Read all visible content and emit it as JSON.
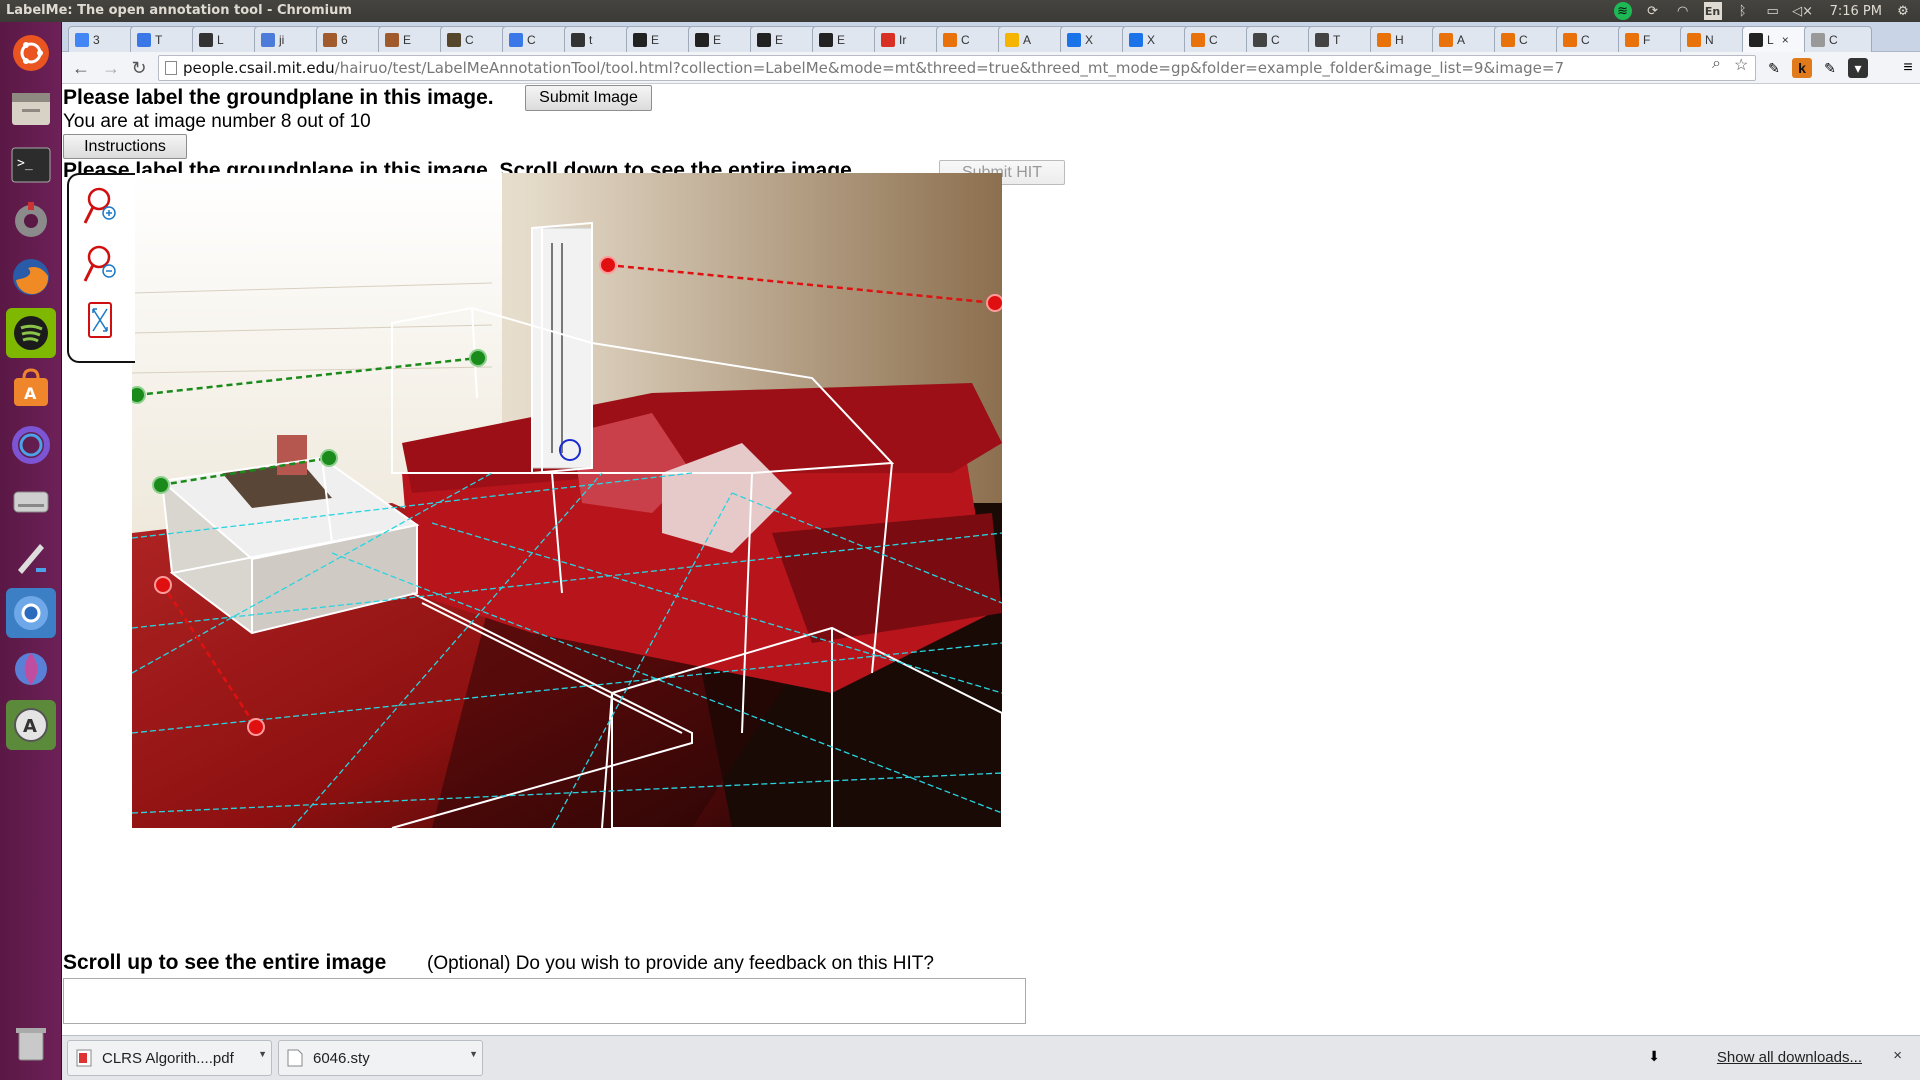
{
  "window": {
    "title": "LabelMe: The open annotation tool - Chromium"
  },
  "tray": {
    "language": "En",
    "clock": "7:16 PM"
  },
  "launcher": {
    "items": [
      "ubuntu-dash-icon",
      "files-icon",
      "terminal-icon",
      "settings-icon",
      "firefox-icon",
      "spotify-icon",
      "software-center-icon",
      "app-icon",
      "drive-icon",
      "text-editor-icon",
      "chromium-icon",
      "shotwell-icon",
      "updater-icon",
      "trash-icon"
    ]
  },
  "tabs": [
    {
      "label": "3",
      "color": "#4285f4"
    },
    {
      "label": "T",
      "color": "#3b78e7"
    },
    {
      "label": "L",
      "color": "#333333"
    },
    {
      "label": "ji",
      "color": "#4c7bd9"
    },
    {
      "label": "6",
      "color": "#a05a2c"
    },
    {
      "label": "E",
      "color": "#a05a2c"
    },
    {
      "label": "C",
      "color": "#55462b"
    },
    {
      "label": "C",
      "color": "#3b78e7"
    },
    {
      "label": "t",
      "color": "#333333"
    },
    {
      "label": "E",
      "color": "#222222"
    },
    {
      "label": "E",
      "color": "#222222"
    },
    {
      "label": "E",
      "color": "#222222"
    },
    {
      "label": "E",
      "color": "#222222"
    },
    {
      "label": "Ir",
      "color": "#d93025"
    },
    {
      "label": "C",
      "color": "#e8710a"
    },
    {
      "label": "A",
      "color": "#f4b400"
    },
    {
      "label": "X",
      "color": "#1a73e8"
    },
    {
      "label": "X",
      "color": "#1a73e8"
    },
    {
      "label": "C",
      "color": "#e8710a"
    },
    {
      "label": "C",
      "color": "#444444"
    },
    {
      "label": "T",
      "color": "#444444"
    },
    {
      "label": "H",
      "color": "#e8710a"
    },
    {
      "label": "A",
      "color": "#e8710a"
    },
    {
      "label": "C",
      "color": "#e8710a"
    },
    {
      "label": "C",
      "color": "#e8710a"
    },
    {
      "label": "F",
      "color": "#e8710a"
    },
    {
      "label": "N",
      "color": "#e8710a"
    },
    {
      "label": "L",
      "color": "#222222",
      "active": true
    },
    {
      "label": "C",
      "color": "#999999"
    }
  ],
  "toolbar": {
    "url_host": "people.csail.mit.edu",
    "url_path": "/hairuo/test/LabelMeAnnotationTool/tool.html?collection=LabelMe&mode=mt&threed=true&threed_mt_mode=gp&folder=example_folder&image_list=9&image=7"
  },
  "page": {
    "heading": "Please label the groundplane in this image.",
    "submit_image": "Submit Image",
    "progress": "You are at image number 8 out of 10",
    "instructions_button": "Instructions",
    "heading2": "Please label the groundplane in this image. Scroll down to see the entire image.",
    "submit_hit": "Submit HIT",
    "scroll_up": "Scroll up to see the entire image",
    "feedback_prompt": "(Optional) Do you wish to provide any feedback on this HIT?",
    "feedback_value": ""
  },
  "tools": [
    "zoom-in-icon",
    "zoom-out-icon",
    "fit-to-screen-icon"
  ],
  "downloads": {
    "items": [
      {
        "name": "CLRS Algorith....pdf",
        "type": "pdf"
      },
      {
        "name": "6046.sty",
        "type": "file"
      }
    ],
    "show_all": "Show all downloads..."
  },
  "colors": {
    "accent_red": "#e01010",
    "accent_green": "#1a8a1a",
    "guide_cyan": "#29d4e0"
  }
}
